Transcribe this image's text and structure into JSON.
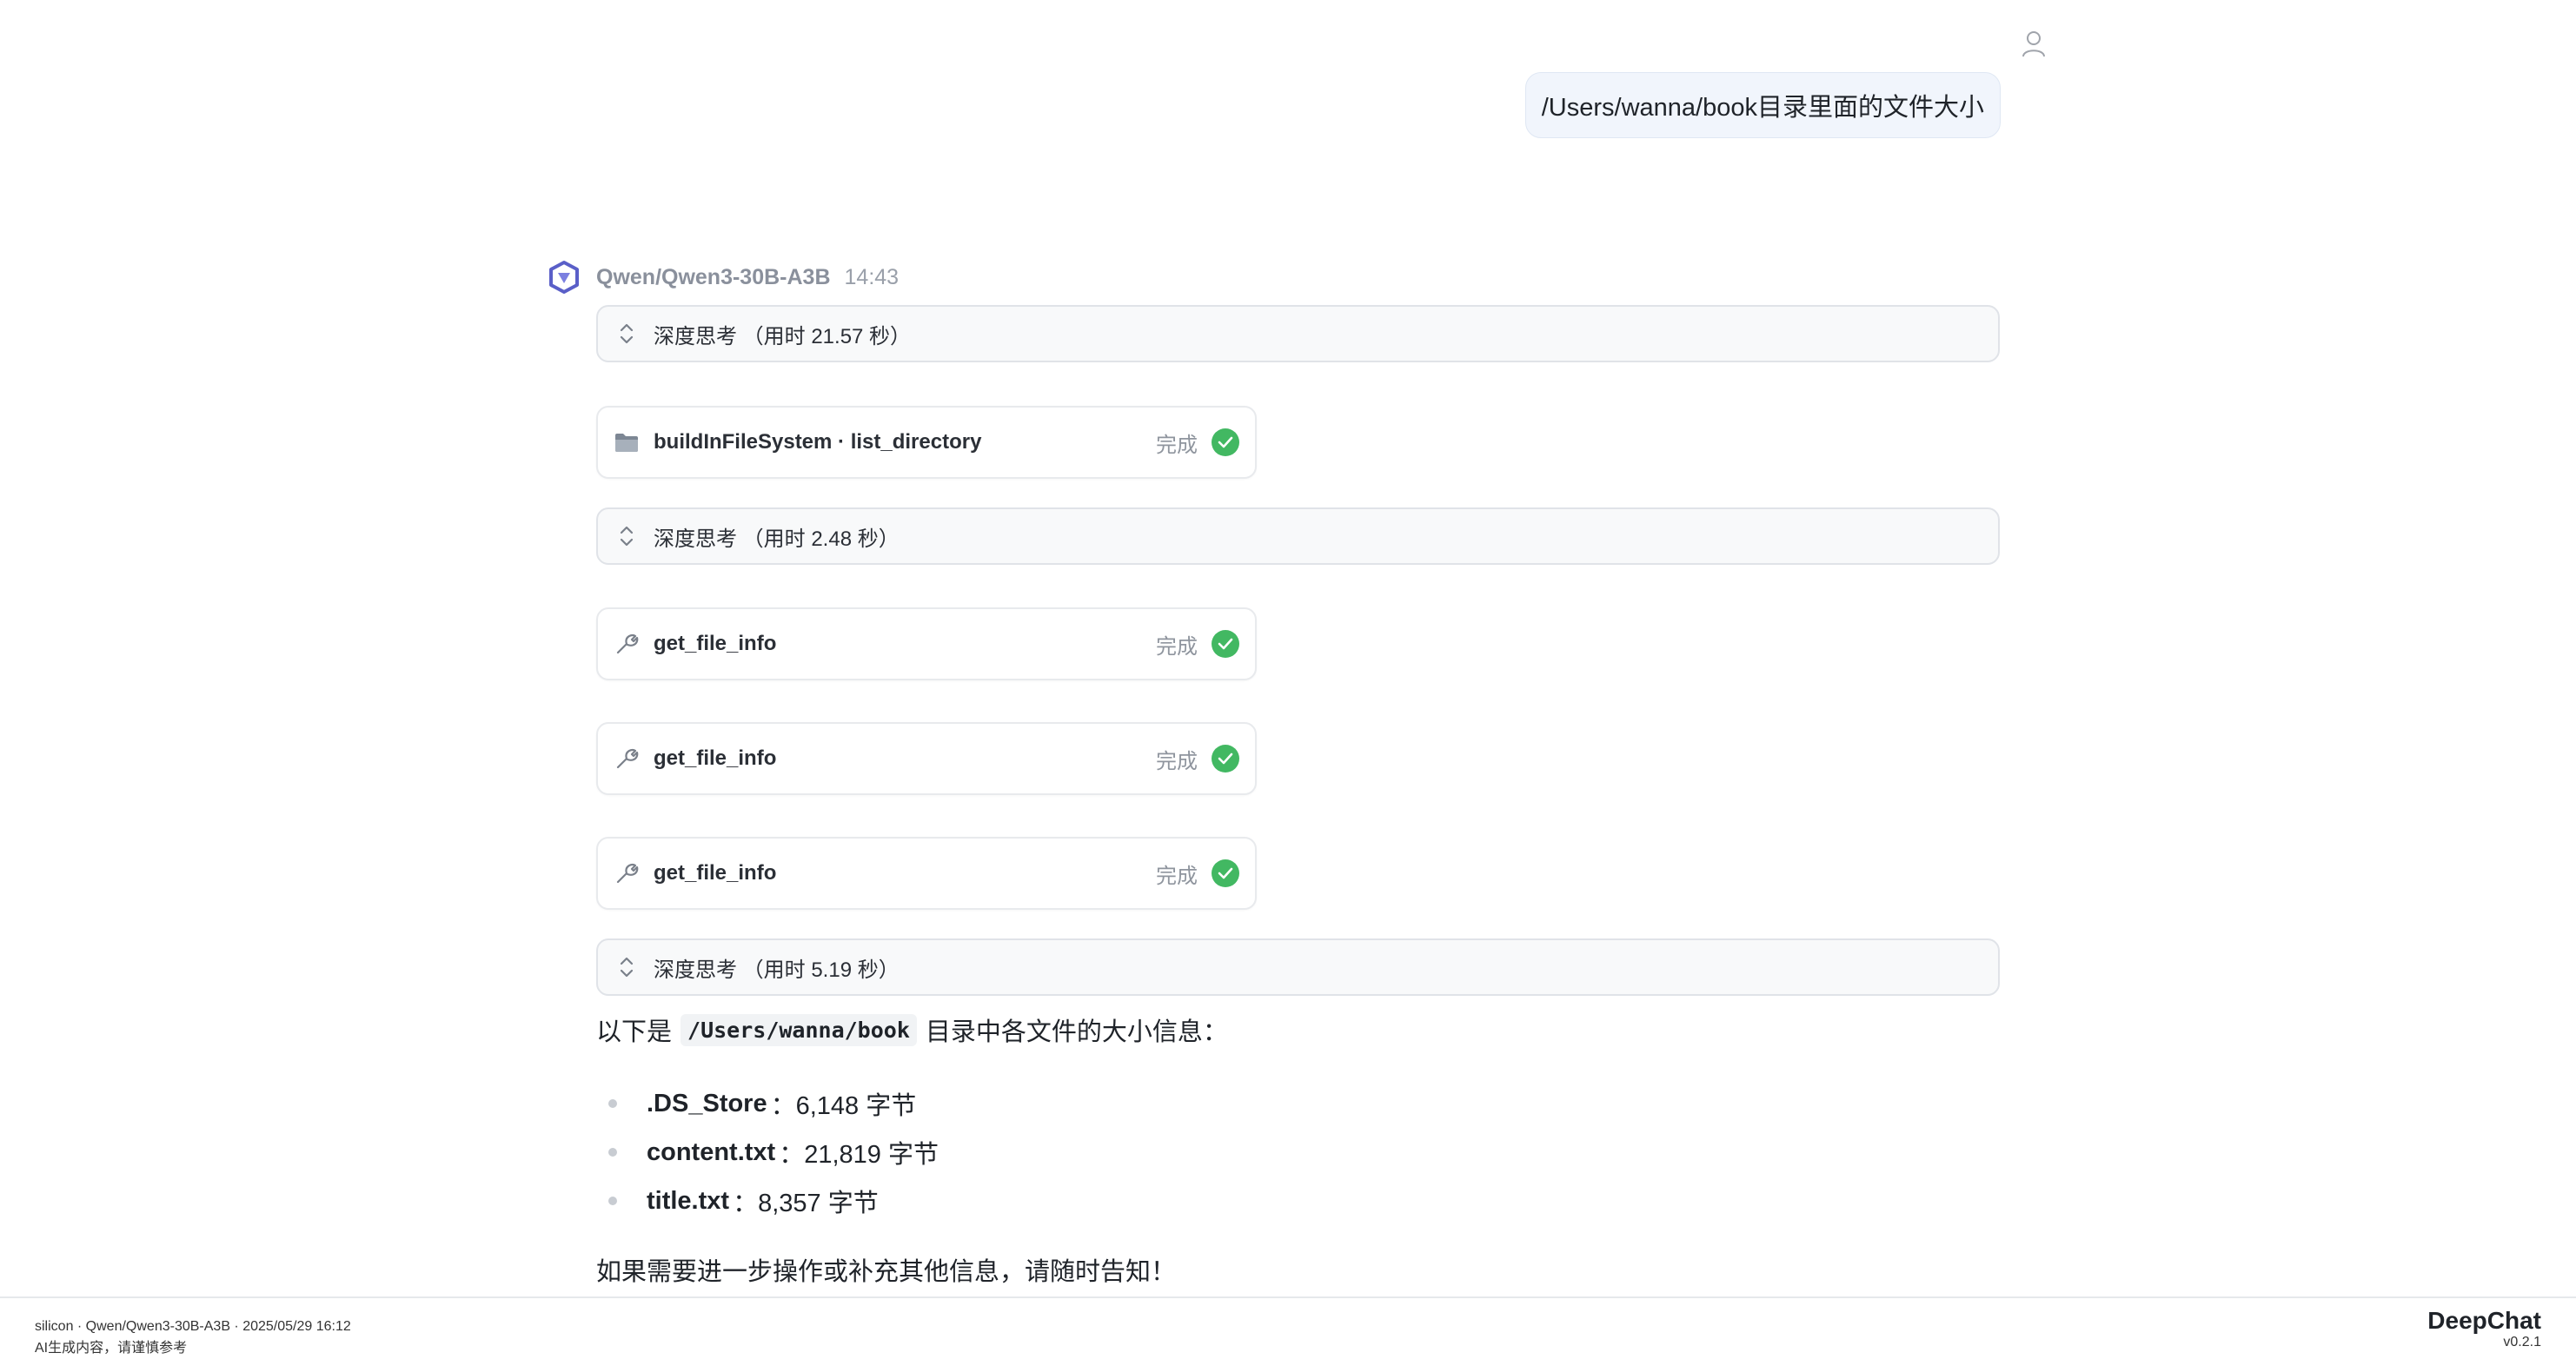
{
  "user_message": {
    "text": "/Users/wanna/book目录里面的文件大小",
    "avatar_icon": "user-icon"
  },
  "assistant": {
    "model": "Qwen/Qwen3-30B-A3B",
    "time": "14:43",
    "avatar_icon": "qwen-logo-icon"
  },
  "blocks": {
    "think1": {
      "label": "深度思考 （用时 21.57 秒）"
    },
    "tool1": {
      "name": "buildInFileSystem · list_directory",
      "status": "完成",
      "icon": "folder-icon"
    },
    "think2": {
      "label": "深度思考 （用时 2.48 秒）"
    },
    "tool2": {
      "name": "get_file_info",
      "status": "完成",
      "icon": "wrench-icon"
    },
    "tool3": {
      "name": "get_file_info",
      "status": "完成",
      "icon": "wrench-icon"
    },
    "tool4": {
      "name": "get_file_info",
      "status": "完成",
      "icon": "wrench-icon"
    },
    "think3": {
      "label": "深度思考 （用时 5.19 秒）"
    }
  },
  "answer": {
    "intro_before": "以下是",
    "intro_code": "/Users/wanna/book",
    "intro_after": "目录中各文件的大小信息：",
    "items": [
      {
        "name": ".DS_Store",
        "value": "：6,148 字节"
      },
      {
        "name": "content.txt",
        "value": "：21,819 字节"
      },
      {
        "name": "title.txt",
        "value": "：8,357 字节"
      }
    ],
    "outro": "如果需要进一步操作或补充其他信息，请随时告知！"
  },
  "footer": {
    "meta_line1": "silicon · Qwen/Qwen3-30B-A3B · 2025/05/29 16:12",
    "meta_line2": "AI生成内容，请谨慎参考",
    "brand": "DeepChat",
    "version": "v0.2.1"
  },
  "colors": {
    "success": "#42b862",
    "bubble_bg": "#f1f5fc",
    "think_bg": "#f8f9fa"
  }
}
